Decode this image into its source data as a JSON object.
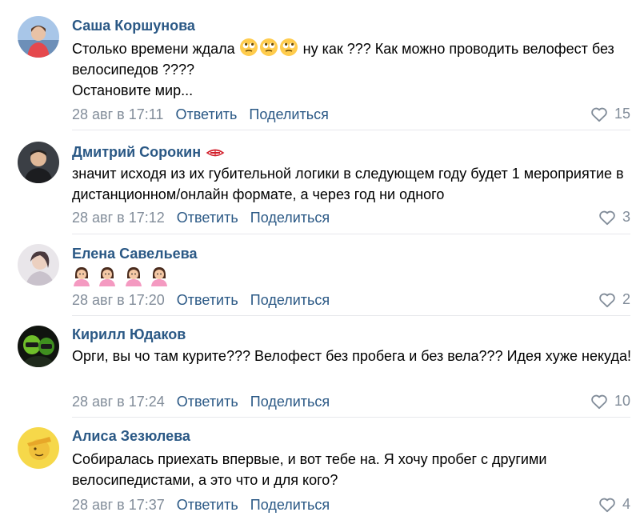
{
  "ui": {
    "reply_label": "Ответить",
    "share_label": "Поделиться"
  },
  "comments": [
    {
      "author": "Саша Коршунова",
      "text_before_emoji": "Столько времени ждала ",
      "emoji": [
        "face-with-rolling-eyes",
        "face-with-rolling-eyes",
        "face-with-rolling-eyes"
      ],
      "text_after_emoji": " ну как ??? Как можно проводить велофест без велосипедов ????",
      "text_line_2": "Остановите мир...",
      "date": "28 авг в 17:11",
      "likes": "15"
    },
    {
      "author": "Дмитрий Сорокин",
      "badge_icon": "spartak-badge-icon",
      "text": "значит исходя из их губительной логики в следующем году будет 1 мероприятие в дистанционном/онлайн формате, а через год ни одного",
      "date": "28 авг в 17:12",
      "likes": "3"
    },
    {
      "author": "Елена Савельева",
      "emoji": [
        "woman-shrugging",
        "woman-shrugging",
        "woman-shrugging",
        "woman-shrugging"
      ],
      "date": "28 авг в 17:20",
      "likes": "2"
    },
    {
      "author": "Кирилл Юдаков",
      "text": "Орги, вы чо там курите??? Велофест без пробега и без вела??? Идея хуже некуда!",
      "date": "28 авг в 17:24",
      "likes": "10"
    },
    {
      "author": "Алиса Зезюлева",
      "text": "Собиралась приехать впервые, и вот тебе на. Я хочу пробег с другими велосипедистами, а это что и для кого?",
      "date": "28 авг в 17:37",
      "likes": "4"
    }
  ],
  "colors": {
    "author": "#2a5885",
    "meta": "#818c99",
    "divider": "#e7e8ec"
  }
}
